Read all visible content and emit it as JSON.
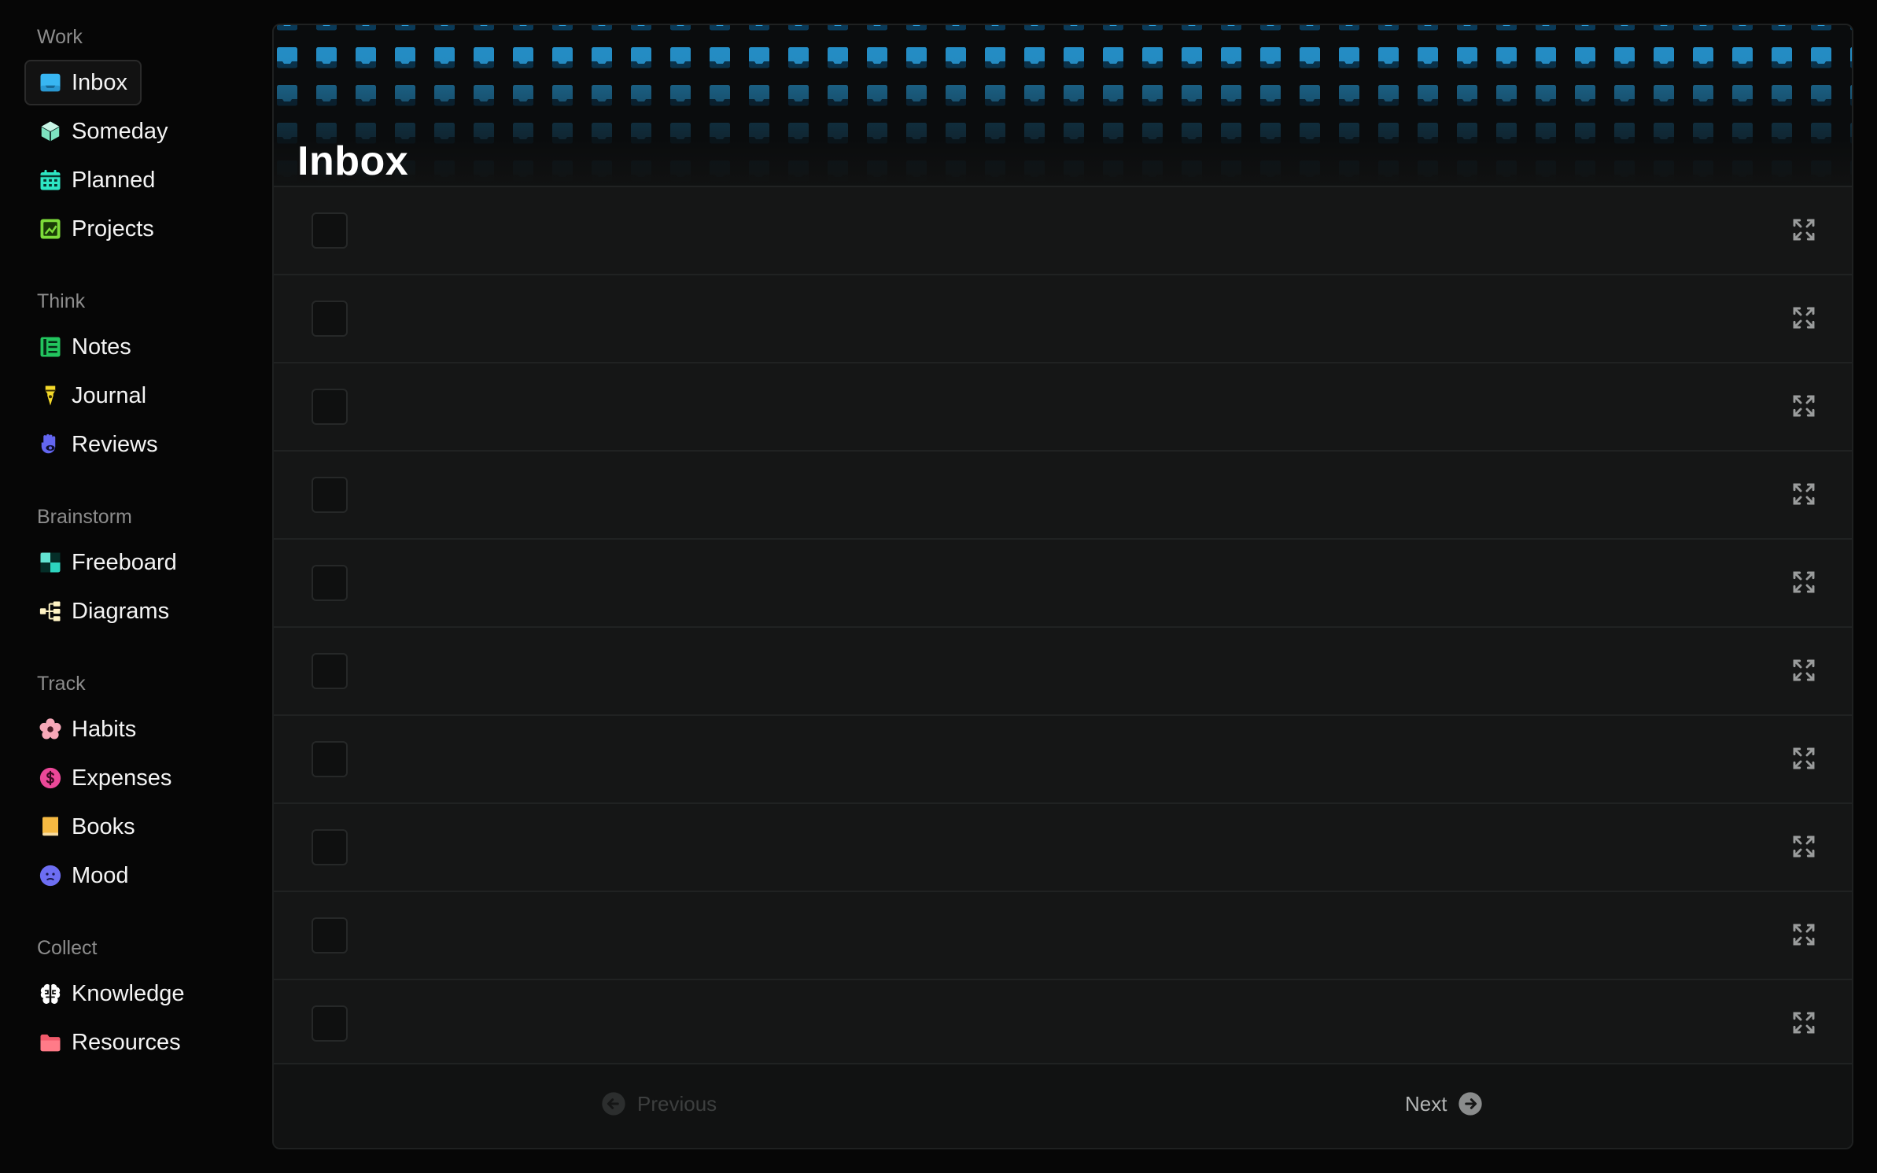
{
  "sidebar": {
    "sections": [
      {
        "label": "Work",
        "items": [
          {
            "label": "Inbox",
            "icon": "inbox-icon",
            "color": "#38b6f2",
            "active": true
          },
          {
            "label": "Someday",
            "icon": "cube-icon",
            "color": "#7de3c0"
          },
          {
            "label": "Planned",
            "icon": "calendar-icon",
            "color": "#2ee6c4"
          },
          {
            "label": "Projects",
            "icon": "project-icon",
            "color": "#7ddc3a"
          }
        ]
      },
      {
        "label": "Think",
        "items": [
          {
            "label": "Notes",
            "icon": "notes-icon",
            "color": "#22c55e"
          },
          {
            "label": "Journal",
            "icon": "pen-nib-icon",
            "color": "#f4d92a"
          },
          {
            "label": "Reviews",
            "icon": "hand-eye-icon",
            "color": "#6366f1"
          }
        ]
      },
      {
        "label": "Brainstorm",
        "items": [
          {
            "label": "Freeboard",
            "icon": "board-icon",
            "color": "#2dd4bf"
          },
          {
            "label": "Diagrams",
            "icon": "diagram-icon",
            "color": "#fff3c4"
          }
        ]
      },
      {
        "label": "Track",
        "items": [
          {
            "label": "Habits",
            "icon": "flower-icon",
            "color": "#f7a8b8"
          },
          {
            "label": "Expenses",
            "icon": "dollar-icon",
            "color": "#ec4899"
          },
          {
            "label": "Books",
            "icon": "book-icon",
            "color": "#f5b942"
          },
          {
            "label": "Mood",
            "icon": "face-icon",
            "color": "#6d6ef2"
          }
        ]
      },
      {
        "label": "Collect",
        "items": [
          {
            "label": "Knowledge",
            "icon": "brain-icon",
            "color": "#ffffff"
          },
          {
            "label": "Resources",
            "icon": "folder-icon",
            "color": "#f05a6a"
          }
        ]
      }
    ]
  },
  "main": {
    "title": "Inbox",
    "row_count": 10,
    "pagination": {
      "previous_label": "Previous",
      "next_label": "Next"
    }
  },
  "colors": {
    "background": "#060606",
    "panel": "#111212",
    "row": "#151616",
    "banner_accent": "#2aa8ea"
  }
}
